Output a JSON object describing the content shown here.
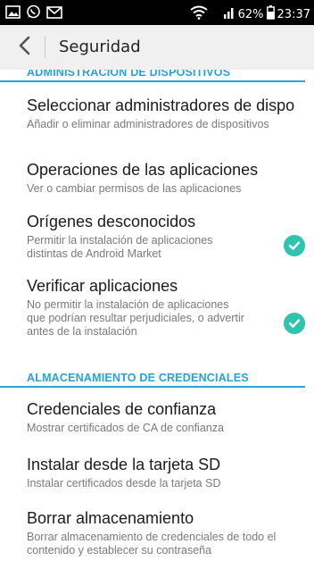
{
  "status_bar": {
    "battery_text": "62%",
    "time": "23:37",
    "icons": [
      "screenshot-icon",
      "whatsapp-icon",
      "mail-icon",
      "wifi-icon",
      "signal-icon",
      "battery-icon"
    ]
  },
  "action_bar": {
    "title": "Seguridad"
  },
  "sections": {
    "admin_header": "ADMINISTRACIÓN DE DISPOSITIVOS",
    "cred_header": "ALMACENAMIENTO DE CREDENCIALES"
  },
  "items": [
    {
      "title": "Seleccionar administradores de dispo",
      "summary": "Añadir o eliminar administradores de dispositivos"
    },
    {
      "title": "Operaciones de las aplicaciones",
      "summary": "Ver o cambiar permisos de las aplicaciones"
    },
    {
      "title": "Orígenes desconocidos",
      "summary": "Permitir la instalación de aplicaciones distintas de Android Market",
      "checked": true
    },
    {
      "title": "Verificar aplicaciones",
      "summary": "No permitir la instalación de aplicaciones que podrían resultar perjudiciales, o advertir antes de la instalación",
      "checked": true
    },
    {
      "title": "Credenciales de confianza",
      "summary": "Mostrar certificados de CA de confianza"
    },
    {
      "title": "Instalar desde la tarjeta SD",
      "summary": "Instalar certificados desde la tarjeta SD"
    },
    {
      "title": "Borrar almacenamiento",
      "summary": "Borrar almacenamiento de credenciales de todo el contenido y establecer su contraseña"
    }
  ],
  "colors": {
    "accent": "#27a2d6",
    "check": "#2ec4b0",
    "status_bar": "#000000",
    "action_bar": "#f0f0f0"
  }
}
